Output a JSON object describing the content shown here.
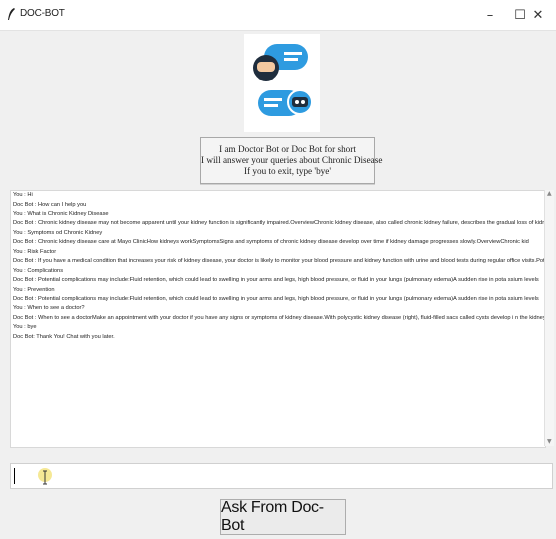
{
  "window": {
    "title": "DOC-BOT",
    "minimize": "–",
    "maximize": "☐",
    "close": "✕"
  },
  "intro": {
    "line1": "I am Doctor Bot or Doc Bot for short",
    "line2": "I will answer your queries about Chronic Disease",
    "line3": "If you to exit, type 'bye'"
  },
  "chat": {
    "lines": [
      "You : Hi",
      "Doc Bot : How can I help you",
      "You : What is Chronic Kidney Disease",
      "Doc Bot : Chronic kidney disease may not become apparent until your kidney function is significantly impaired.OverviewChronic kidney disease, also called chronic kidney failure, describes the gradual      loss of kidney",
      "You : Symptoms od Chronic Kidney",
      "Doc Bot : Chronic kidney disease care at Mayo ClinicHow kidneys workSymptomsSigns and symptoms of chronic kidney disease develop over time if kidney damage progresses slowly.OverviewChronic kid",
      "You : Risk Factor",
      "Doc Bot : If you have a medical condition that increases your risk of kidney disease, your doctor is likely to monitor your blood pressure and kidney function with urine and blood tests during regular office visits.Potenti",
      "You : Complications",
      "Doc Bot : Potential complications may include:Fluid retention, which could lead to swelling in your arms and legs, high blood pressure, or fluid in your lungs (pulmonary edema)A sudden rise in pota         ssium levels",
      "You : Prevention",
      "Doc Bot : Potential complications may include:Fluid retention, which could lead to swelling in your arms and legs, high blood pressure, or fluid in your lungs (pulmonary edema)A sudden rise in pota         ssium levels",
      "You : When to see a doctor?",
      "Doc Bot : When to see a doctorMake an appointment with your doctor if you have any signs or symptoms of kidney disease.With polycystic kidney disease (right), fluid-filled sacs called cysts develop i    n the kidneys,",
      "You : bye",
      "Doc Bot: Thank You! Chat with you later."
    ]
  },
  "input": {
    "value": ""
  },
  "ask_button": {
    "label": "Ask From Doc-Bot"
  },
  "colors": {
    "bubble_blue": "#2e9be0",
    "avatar_dark": "#1f2d3d",
    "avatar_skin": "#f2c8a0"
  },
  "icons": [
    "feather-icon",
    "doctor-bot-logo",
    "text-cursor-icon"
  ]
}
